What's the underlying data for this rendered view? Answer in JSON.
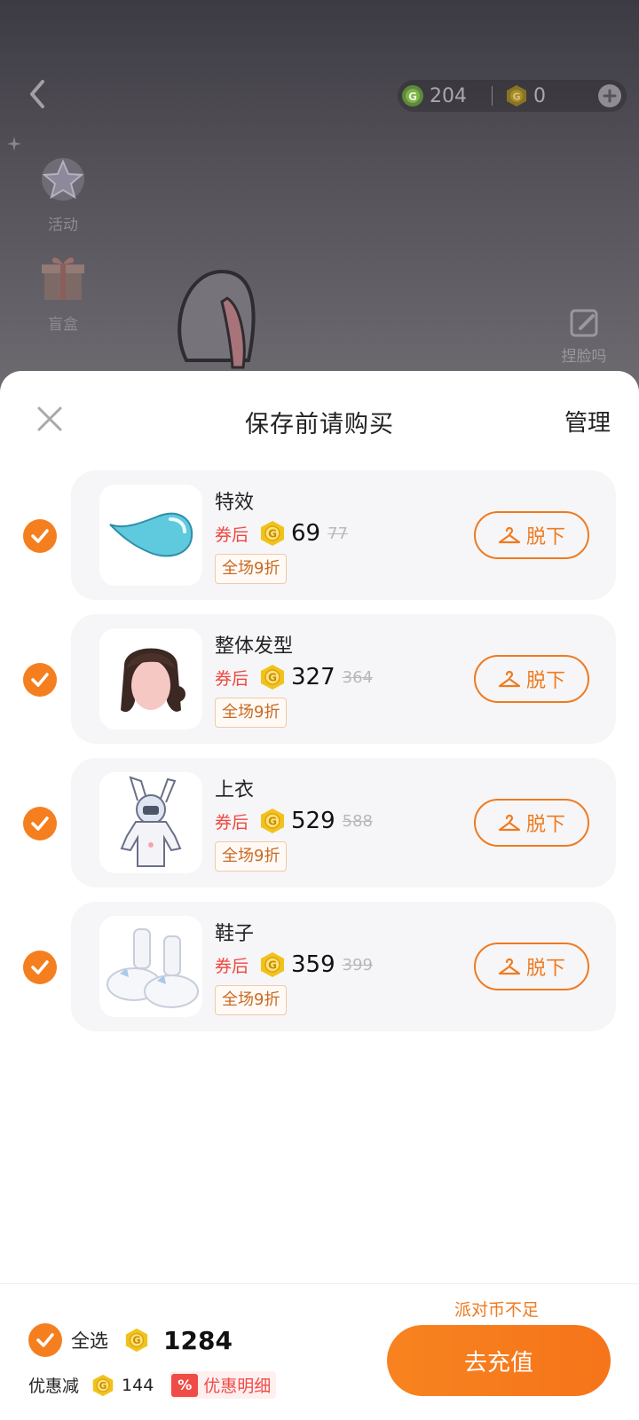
{
  "background": {
    "currency": [
      {
        "icon": "green-coin-icon",
        "value": "204"
      },
      {
        "icon": "gold-coin-icon",
        "value": "0"
      }
    ],
    "side_entries": [
      {
        "icon": "star-activity-icon",
        "label": "活动"
      },
      {
        "icon": "blind-box-icon",
        "label": "盲盒"
      }
    ],
    "face_btn_label": "捏脸吗"
  },
  "sheet": {
    "title": "保存前请购买",
    "manage_label": "管理",
    "items": [
      {
        "name": "特效",
        "coupon_label": "券后",
        "price": "69",
        "original_price": "77",
        "discount_tag": "全场9折",
        "action_label": "脱下",
        "checked": true,
        "thumb": "blue-drop-effect"
      },
      {
        "name": "整体发型",
        "coupon_label": "券后",
        "price": "327",
        "original_price": "364",
        "discount_tag": "全场9折",
        "action_label": "脱下",
        "checked": true,
        "thumb": "brown-hairstyle"
      },
      {
        "name": "上衣",
        "coupon_label": "券后",
        "price": "529",
        "original_price": "588",
        "discount_tag": "全场9折",
        "action_label": "脱下",
        "checked": true,
        "thumb": "bunny-hoodie"
      },
      {
        "name": "鞋子",
        "coupon_label": "券后",
        "price": "359",
        "original_price": "399",
        "discount_tag": "全场9折",
        "action_label": "脱下",
        "checked": true,
        "thumb": "fluffy-boots"
      }
    ]
  },
  "footer": {
    "insufficient_text": "派对币不足",
    "select_all_label": "全选",
    "total": "1284",
    "discount_label": "优惠减",
    "discount_amount": "144",
    "detail_badge": "%",
    "detail_label": "优惠明细",
    "recharge_label": "去充值"
  },
  "colors": {
    "accent": "#f57f1f",
    "coupon_red": "#f0463f",
    "coin_gold": "#f2c21b"
  }
}
